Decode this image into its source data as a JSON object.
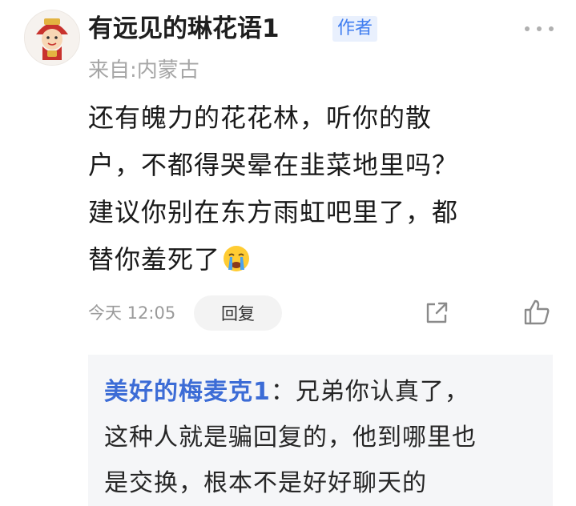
{
  "comment": {
    "username": "有远见的琳花语1",
    "author_badge": "作者",
    "location": "来自:内蒙古",
    "content_lines": [
      "还有魄力的花花林，听你的散",
      "户，不都得哭晕在韭菜地里吗？",
      "建议你别在东方雨虹吧里了，都",
      "替你羞死了"
    ],
    "emoji": "crying-face-icon",
    "time": "今天 12:05",
    "reply_label": "回复"
  },
  "reply": {
    "name": "美好的梅麦克1",
    "separator": "：",
    "lines": [
      "兄弟你认真了，",
      "这种人就是骗回复的，他到哪里也",
      "是交换，根本不是好好聊天的"
    ]
  },
  "icons": {
    "more": "more-dots-icon",
    "share": "share-icon",
    "like": "thumbs-up-icon"
  },
  "colors": {
    "badge_text": "#3f7df0",
    "badge_bg": "#e9f0fd",
    "reply_name": "#3c6cd6",
    "reply_bg": "#f5f6f8"
  }
}
